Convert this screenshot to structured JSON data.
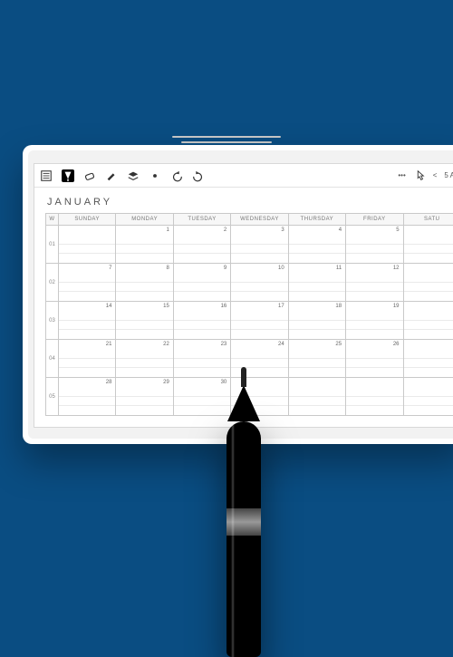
{
  "toolbar": {
    "icons": [
      "menu",
      "pen",
      "eraser",
      "highlighter",
      "layers",
      "dot",
      "undo",
      "redo"
    ],
    "more": "•••",
    "pointer_icon": "pointer",
    "nav_prev": "<",
    "page_label": "5 A"
  },
  "month": "JANUARY",
  "header": {
    "week": "W",
    "days": [
      "SUNDAY",
      "MONDAY",
      "TUESDAY",
      "WEDNESDAY",
      "THURSDAY",
      "FRIDAY",
      "SATU"
    ]
  },
  "rows": [
    {
      "wk": "01",
      "days": [
        "",
        "1",
        "2",
        "3",
        "4",
        "5",
        ""
      ]
    },
    {
      "wk": "02",
      "days": [
        "7",
        "8",
        "9",
        "10",
        "11",
        "12",
        ""
      ]
    },
    {
      "wk": "03",
      "days": [
        "14",
        "15",
        "16",
        "17",
        "18",
        "19",
        ""
      ]
    },
    {
      "wk": "04",
      "days": [
        "21",
        "22",
        "23",
        "24",
        "25",
        "26",
        ""
      ]
    },
    {
      "wk": "05",
      "days": [
        "28",
        "29",
        "30",
        "",
        "",
        "",
        ""
      ]
    }
  ]
}
